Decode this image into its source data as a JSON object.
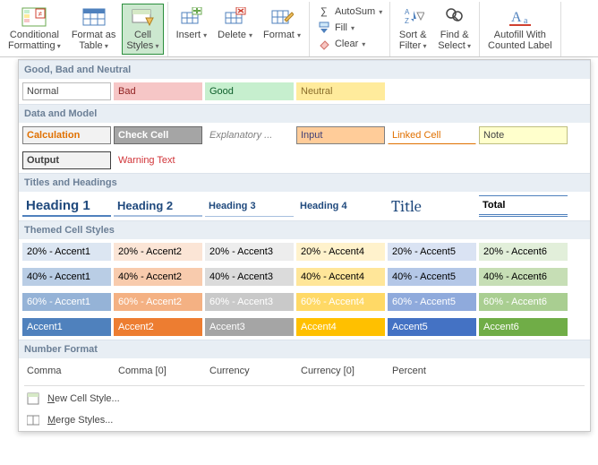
{
  "ribbon": {
    "conditional": "Conditional\nFormatting",
    "format_table": "Format as\nTable",
    "cell_styles": "Cell\nStyles",
    "insert": "Insert",
    "delete": "Delete",
    "format": "Format",
    "autosum": "AutoSum",
    "fill": "Fill",
    "clear": "Clear",
    "sort_filter": "Sort &\nFilter",
    "find_select": "Find &\nSelect",
    "autofill": "Autofill With\nCounted Label"
  },
  "gallery": {
    "sections": {
      "gbn": "Good, Bad and Neutral",
      "dm": "Data and Model",
      "th": "Titles and Headings",
      "tcs": "Themed Cell Styles",
      "nf": "Number Format"
    },
    "gbn": [
      "Normal",
      "Bad",
      "Good",
      "Neutral"
    ],
    "dm_row1": [
      "Calculation",
      "Check Cell",
      "Explanatory ...",
      "Input",
      "Linked Cell",
      "Note"
    ],
    "dm_row2": [
      "Output",
      "Warning Text"
    ],
    "th": [
      "Heading 1",
      "Heading 2",
      "Heading 3",
      "Heading 4",
      "Title",
      "Total"
    ],
    "accents_rows": [
      "20% - Accent",
      "40% - Accent",
      "60% - Accent",
      "Accent"
    ],
    "nf": [
      "Comma",
      "Comma [0]",
      "Currency",
      "Currency [0]",
      "Percent"
    ],
    "new_style": "New Cell Style...",
    "merge_styles": "Merge Styles..."
  },
  "colors": {
    "bad_bg": "#f6c6c6",
    "bad_fg": "#8e1f1f",
    "good_bg": "#c6efce",
    "good_fg": "#0e5f2b",
    "neutral_bg": "#ffeb9c",
    "neutral_fg": "#8a6d2b",
    "calc_border": "#808080",
    "calc_fg": "#e07000",
    "calc_bg": "#f2f2f2",
    "check_bg": "#a5a5a5",
    "check_fg": "#ffffff",
    "explan_fg": "#7f7f7f",
    "input_bg": "#ffcc99",
    "input_fg": "#3f3f76",
    "linked_fg": "#e07000",
    "note_bg": "#ffffcc",
    "output_bg": "#f2f2f2",
    "output_fg": "#3f3f3f",
    "warn_fg": "#d13438",
    "title_fg": "#1f497d",
    "accent1": "#4f81bd",
    "accent2": "#ed7d31",
    "accent3": "#a5a5a5",
    "accent4": "#ffc000",
    "accent5": "#4472c4",
    "accent6": "#70ad47"
  }
}
